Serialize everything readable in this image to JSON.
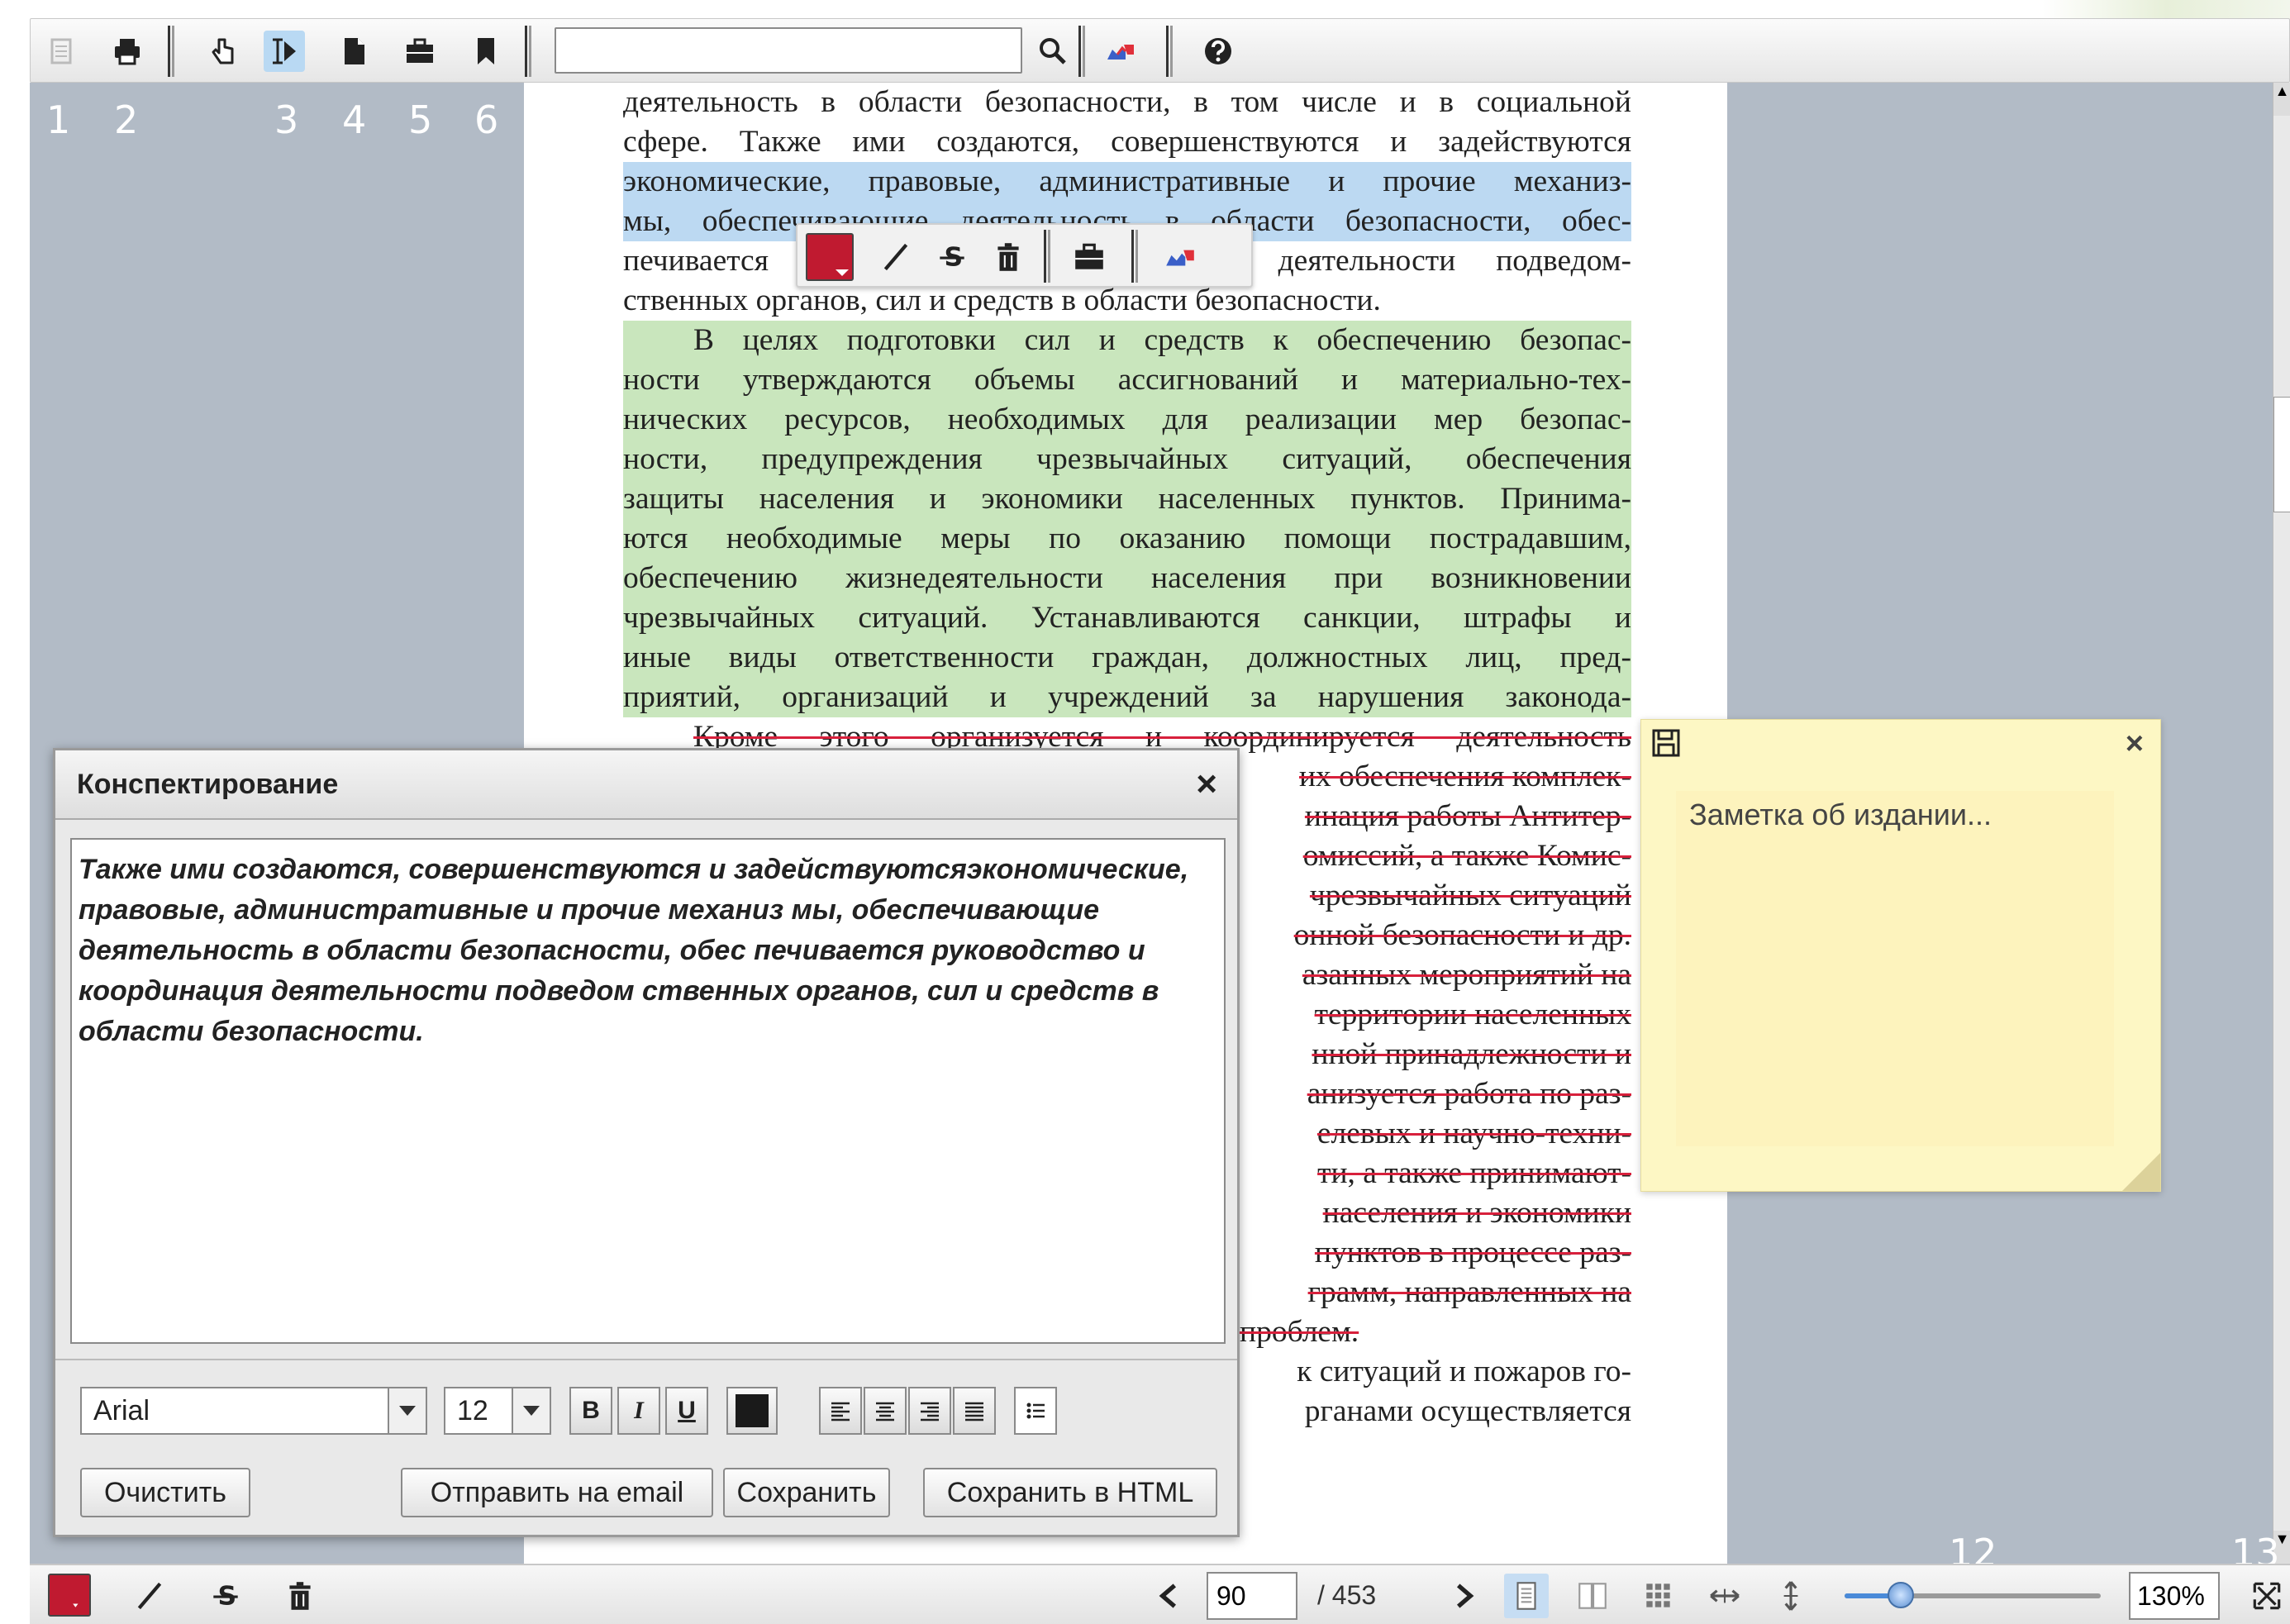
{
  "toolbar": {
    "search": {
      "value": "",
      "placeholder": ""
    }
  },
  "markers": [
    "1",
    "2",
    "3",
    "4",
    "5",
    "6",
    "12",
    "13"
  ],
  "page_text": [
    "деятельность в области безопасности, в том числе и в социальной",
    "сфере. Также ими создаются, совершенствуются и задействуются",
    "экономические, правовые, административные и прочие механиз-",
    "мы, обеспечивающие деятельность в области безопасности, обес-",
    "печивается руководство и координация деятельности подведом-",
    "ственных органов, сил и средств в области безопасности.",
    "В целях подготовки сил и средств к обеспечению безопас-",
    "ности утверждаются объемы ассигнований и материально-тех-",
    "нических ресурсов, необходимых для реализации мер безопас-",
    "ности, предупреждения чрезвычайных ситуаций, обеспечения",
    "защиты населения и экономики населенных пунктов. Принима-",
    "ются необходимые меры по оказанию помощи пострадавшим,",
    "обеспечению жизнедеятельности населения при возникновении",
    "чрезвычайных ситуаций. Устанавливаются санкции, штрафы и",
    "иные виды ответственности граждан, должностных лиц, пред-",
    "приятий, организаций и учреждений за нарушения законода-",
    "Кроме этого организуется и координируется деятельность",
    "их обеспечения комплек-",
    "инация работы Антитер-",
    "омиссий, а также Комис-",
    "чрезвычайных ситуаций",
    "онной безопасности и др.",
    "азанных мероприятий на",
    "территории населенных",
    "нной принадлежности и",
    "анизуется работа по раз-",
    "елевых и научно-техни-",
    "ти, а также принимают-",
    "населения и экономики",
    "пунктов в процессе раз-",
    "грамм, направленных на",
    "проблем.",
    "к ситуаций и пожаров го-",
    "рганами осуществляется"
  ],
  "note": {
    "placeholder": "Заметка об издании..."
  },
  "dialog": {
    "title": "Конспектирование",
    "close": "×",
    "body": "Также ими создаются, совершенствуются и задействуютсяэкономические, правовые, административные и прочие механиз мы, обеспечивающие деятельность в области безопасности, обес печивается руководство и координация деятельности подведом ственных органов, сил и средств в области безопасности.",
    "font": "Arial",
    "size": "12",
    "bold": "B",
    "italic": "I",
    "underline": "U",
    "buttons": {
      "clear": "Очистить",
      "email": "Отправить на email",
      "save": "Сохранить",
      "save_html": "Сохранить в HTML"
    }
  },
  "bottombar": {
    "page": "90",
    "total": "/ 453",
    "zoom": "130%",
    "zoom_fraction": 0.22
  },
  "colors": {
    "annotation_red": "#c01a30",
    "highlight_green": "#c9e6bd",
    "highlight_blue": "#bcd9f2",
    "gray_bg": "#b2bbc6"
  }
}
